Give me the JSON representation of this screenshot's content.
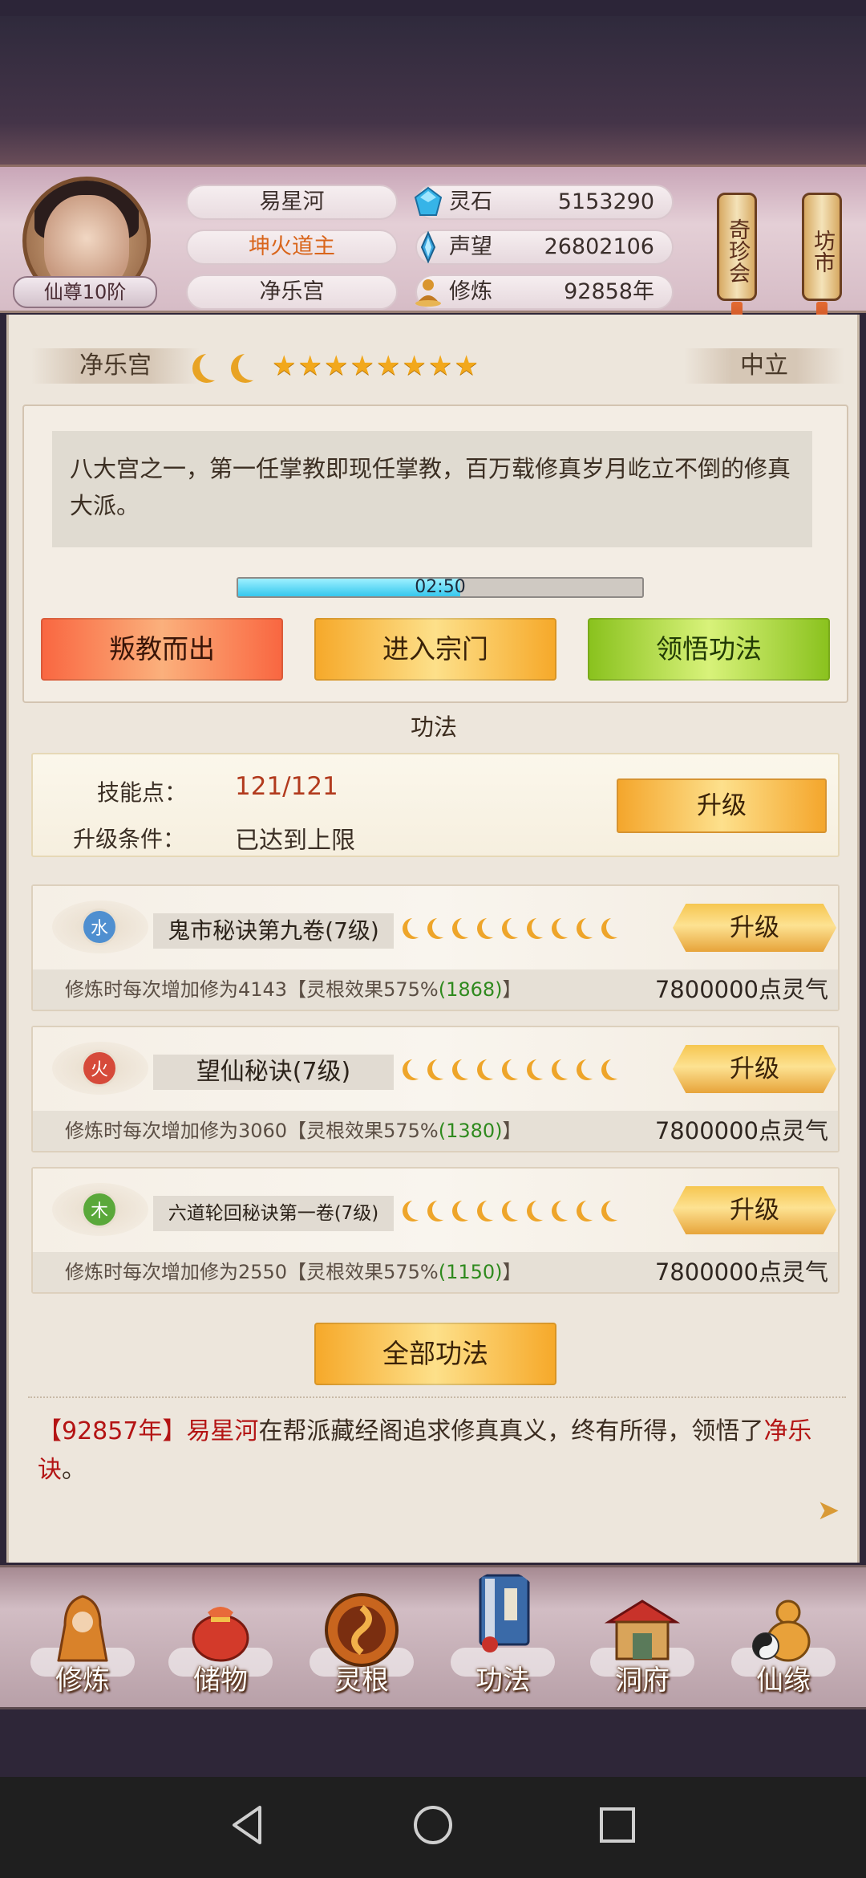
{
  "player": {
    "name": "易星河",
    "title": "坤火道主",
    "sect": "净乐宫",
    "rank": "仙尊10阶"
  },
  "resources": [
    {
      "name": "灵石",
      "value": "5153290",
      "icon": "spirit-stone-icon"
    },
    {
      "name": "声望",
      "value": "26802106",
      "icon": "reputation-icon"
    },
    {
      "name": "修炼",
      "value": "92858年",
      "icon": "cultivation-icon"
    }
  ],
  "side_buttons": {
    "treasure": "奇珍会",
    "market": "坊市"
  },
  "sect_panel": {
    "name": "净乐宫",
    "stance": "中立",
    "rating": {
      "moons": 2,
      "stars": 8
    },
    "description": "八大宫之一，第一任掌教即现任掌教，百万载修真岁月屹立不倒的修真大派。",
    "timer": "02:50",
    "timer_progress": 0.55,
    "buttons": {
      "betray": "叛教而出",
      "enter": "进入宗门",
      "comprehend": "领悟功法"
    }
  },
  "skills_section": {
    "title": "功法",
    "points_label": "技能点：",
    "points_value": "121/121",
    "condition_label": "升级条件：",
    "condition_value": "已达到上限",
    "upgrade_label": "升级"
  },
  "skills": [
    {
      "element": "水",
      "element_color": "#4f8fd0",
      "name": "鬼市秘诀第九卷(7级)",
      "moons": 9,
      "desc_prefix": "修炼时每次增加修为4143【灵根效果575%",
      "desc_bonus": "(1868)",
      "desc_suffix": "】",
      "cost": "7800000点灵气",
      "button": "升级"
    },
    {
      "element": "火",
      "element_color": "#d64a3a",
      "name": "望仙秘诀(7级)",
      "moons": 9,
      "desc_prefix": "修炼时每次增加修为3060【灵根效果575%",
      "desc_bonus": "(1380)",
      "desc_suffix": "】",
      "cost": "7800000点灵气",
      "button": "升级"
    },
    {
      "element": "木",
      "element_color": "#5aa83a",
      "name": "六道轮回秘诀第一卷(7级)",
      "moons": 9,
      "desc_prefix": "修炼时每次增加修为2550【灵根效果575%",
      "desc_bonus": "(1150)",
      "desc_suffix": "】",
      "cost": "7800000点灵气",
      "button": "升级"
    }
  ],
  "all_skills_button": "全部功法",
  "log": {
    "year": "【92857年】",
    "name": "易星河",
    "text": "在帮派藏经阁追求修真真义，终有所得，领悟了",
    "skill": "净乐诀",
    "end": "。"
  },
  "nav": [
    {
      "label": "修炼",
      "icon": "cultivate-icon"
    },
    {
      "label": "储物",
      "icon": "storage-bag-icon"
    },
    {
      "label": "灵根",
      "icon": "spirit-root-icon"
    },
    {
      "label": "功法",
      "icon": "skill-book-icon"
    },
    {
      "label": "洞府",
      "icon": "cave-house-icon"
    },
    {
      "label": "仙缘",
      "icon": "immortal-fate-icon"
    }
  ]
}
